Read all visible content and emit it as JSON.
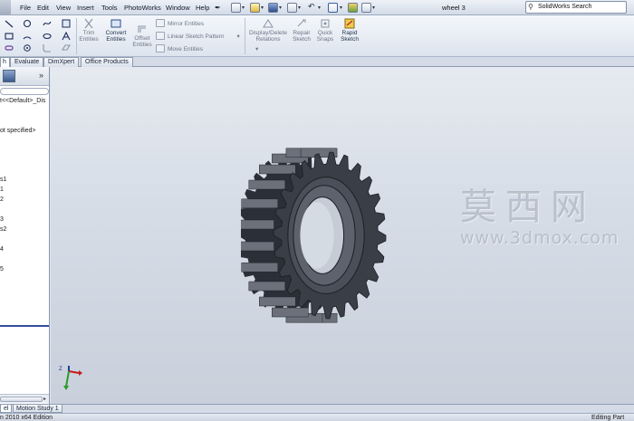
{
  "menubar": {
    "items": [
      "File",
      "Edit",
      "View",
      "Insert",
      "Tools",
      "PhotoWorks",
      "Window",
      "Help"
    ],
    "document_title": "wheel 3",
    "search_placeholder": "SolidWorks Search"
  },
  "command_manager": {
    "trim_entities": "Trim\nEntities",
    "convert_entities": "Convert\nEntities",
    "offset_entities": "Offset\nEntities",
    "mirror_entities": "Mirror Entities",
    "linear_sketch_pattern": "Linear Sketch Pattern",
    "move_entities": "Move Entities",
    "display_delete_relations": "Display/Delete\nRelations",
    "repair_sketch": "Repair\nSketch",
    "quick_snaps": "Quick\nSnaps",
    "rapid_sketch": "Rapid\nSketch"
  },
  "tabs": [
    "h",
    "Evaluate",
    "DimXpert",
    "Office Products"
  ],
  "feature_tree": {
    "lines": [
      "t<<Default>_Dis",
      "ot specified>",
      "s1",
      "1",
      "2",
      "3",
      "s2",
      "4",
      "5"
    ]
  },
  "bottom_tabs": [
    "el",
    "Motion Study 1"
  ],
  "status": {
    "left": "n 2010 x64 Edition",
    "right": "Editing Part"
  },
  "watermark": {
    "chinese": "莫西网",
    "url": "www.3dmox.com"
  },
  "colors": {
    "viewport_bg": "#d6dde7",
    "gear": "#3a3e47",
    "accent": "#334f9a"
  }
}
